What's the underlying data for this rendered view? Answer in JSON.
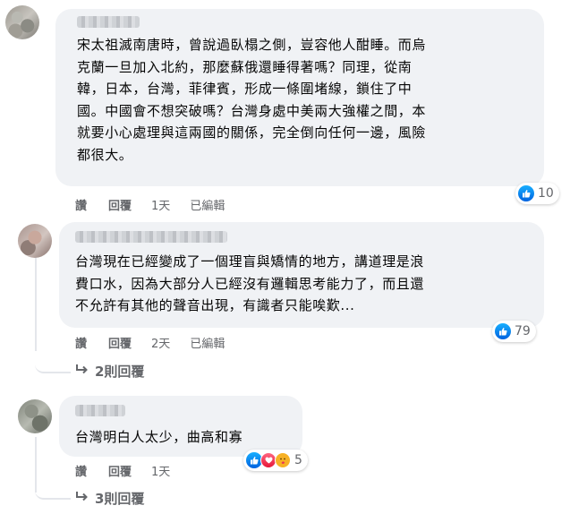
{
  "comments": [
    {
      "lines": [
        "宋太祖滅南唐時，曾說過臥榻之側，豈容他人酣睡。而烏",
        "克蘭一旦加入北約，那麼蘇俄還睡得著嗎？同理，從南",
        "韓，日本，台灣，菲律賓，形成一條圍堵線，鎖住了中",
        "國。中國會不想突破嗎？台灣身處中美兩大強權之間，本",
        "就要小心處理與這兩國的關係，完全倒向任何一邊，風險",
        "都很大。"
      ],
      "actions": {
        "like": "讚",
        "reply": "回覆",
        "time": "1天",
        "edited": "已編輯"
      },
      "reaction_count": "10"
    },
    {
      "lines": [
        "台灣現在已經變成了一個理盲與矯情的地方，講道理是浪",
        "費口水，因為大部分人已經沒有邏輯思考能力了，而且還",
        "不允許有其他的聲音出現，有識者只能唉歎..."
      ],
      "actions": {
        "like": "讚",
        "reply": "回覆",
        "time": "2天",
        "edited": "已編輯"
      },
      "reaction_count": "79",
      "replies_link": "2則回覆"
    },
    {
      "lines": [
        "台灣明白人太少，曲高和寡"
      ],
      "actions": {
        "like": "讚",
        "reply": "回覆",
        "time": "1天"
      },
      "reaction_count": "5",
      "replies_link": "3則回覆"
    }
  ],
  "icons": {
    "reply_arrow": "reply-arrow-icon",
    "like": "like-icon",
    "love": "love-icon",
    "care": "care-icon"
  },
  "colors": {
    "bubble": "#f0f2f5",
    "secondary_text": "#65676b",
    "like_blue": "#1877f2"
  }
}
